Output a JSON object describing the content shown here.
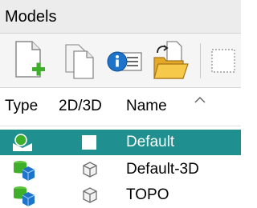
{
  "panel": {
    "title": "Models"
  },
  "toolbar": {
    "buttons": [
      {
        "icon": "new-document-icon",
        "tooltip": ""
      },
      {
        "icon": "copy-icon",
        "tooltip": ""
      },
      {
        "icon": "info-list-icon",
        "tooltip": ""
      },
      {
        "icon": "open-folder-icon",
        "tooltip": ""
      },
      {
        "icon": "select-box-icon",
        "tooltip": ""
      }
    ]
  },
  "table": {
    "columns": {
      "type": "Type",
      "dim": "2D/3D",
      "name": "Name"
    },
    "sort": {
      "column": "Name",
      "direction": "ascending"
    },
    "rows": [
      {
        "type_icon": "2d-model-icon",
        "dim_icon": "2d-square-icon",
        "name": "Default",
        "selected": true
      },
      {
        "type_icon": "3d-model-icon",
        "dim_icon": "3d-cube-icon",
        "name": "Default-3D",
        "selected": false
      },
      {
        "type_icon": "3d-model-icon",
        "dim_icon": "3d-cube-icon",
        "name": "TOPO",
        "selected": false
      }
    ]
  },
  "colors": {
    "selection": "#1f8f8f",
    "green": "#3fae2a",
    "blue": "#1e74c9"
  }
}
